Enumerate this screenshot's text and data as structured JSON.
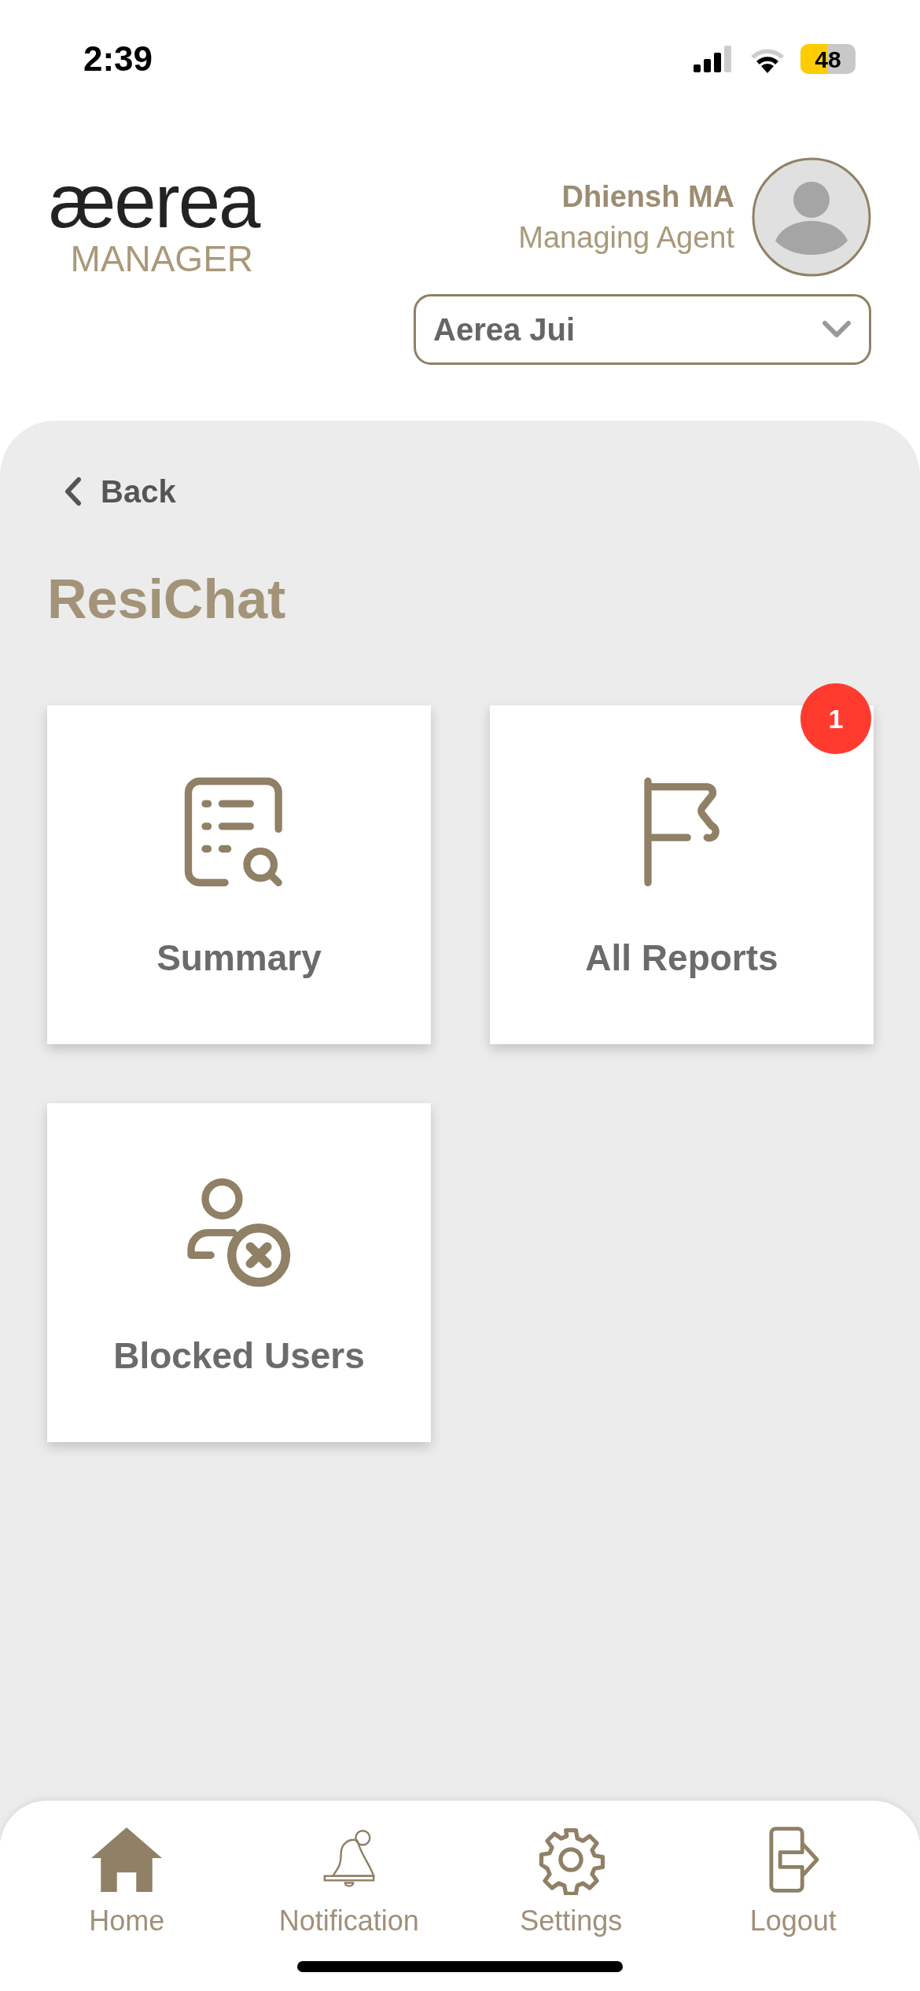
{
  "status_bar": {
    "time": "2:39",
    "battery": "48"
  },
  "header": {
    "logo": {
      "wordmark": "æerea",
      "subtitle": "MANAGER"
    },
    "user": {
      "name": "Dhiensh MA",
      "role": "Managing Agent"
    },
    "property_select": {
      "value": "Aerea Jui"
    }
  },
  "back": {
    "label": "Back"
  },
  "title": "ResiChat",
  "tiles": [
    {
      "kind": "summary",
      "label": "Summary"
    },
    {
      "kind": "reports",
      "label": "All Reports",
      "badge": "1"
    },
    {
      "kind": "blocked",
      "label": "Blocked Users"
    }
  ],
  "nav": [
    {
      "kind": "home",
      "label": "Home"
    },
    {
      "kind": "notification",
      "label": "Notification"
    },
    {
      "kind": "settings",
      "label": "Settings"
    },
    {
      "kind": "logout",
      "label": "Logout"
    }
  ]
}
